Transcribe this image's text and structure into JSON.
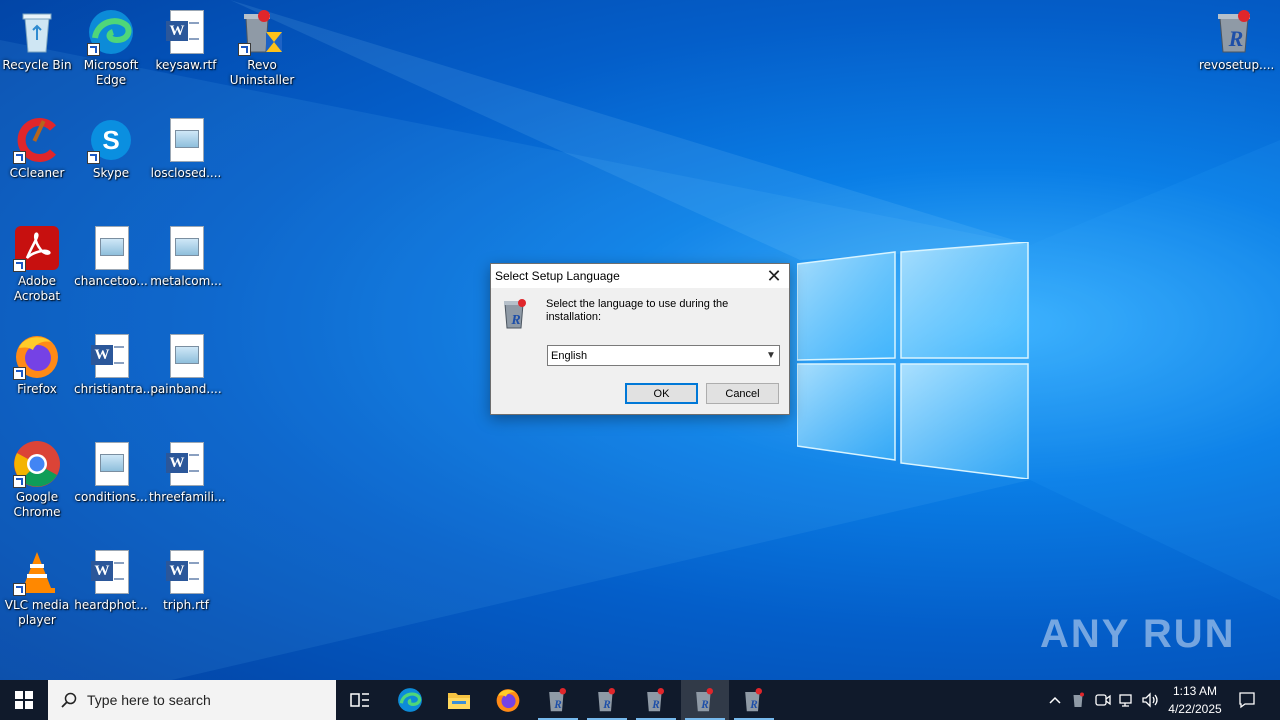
{
  "desktop": {
    "icons": [
      {
        "label": "Recycle Bin"
      },
      {
        "label": "Microsoft Edge"
      },
      {
        "label": "keysaw.rtf"
      },
      {
        "label": "Revo Uninstaller"
      },
      {
        "label": "CCleaner"
      },
      {
        "label": "Skype"
      },
      {
        "label": "losclosed...."
      },
      {
        "label": "Adobe Acrobat"
      },
      {
        "label": "chancetoo..."
      },
      {
        "label": "metalcom..."
      },
      {
        "label": "Firefox"
      },
      {
        "label": "christiantra..."
      },
      {
        "label": "painband...."
      },
      {
        "label": "Google Chrome"
      },
      {
        "label": "conditions..."
      },
      {
        "label": "threefamili..."
      },
      {
        "label": "VLC media player"
      },
      {
        "label": "heardphot..."
      },
      {
        "label": "triph.rtf"
      },
      {
        "label": "revosetup...."
      }
    ]
  },
  "dialog": {
    "title": "Select Setup Language",
    "message": "Select the language to use during the installation:",
    "selected_language": "English",
    "ok_label": "OK",
    "cancel_label": "Cancel"
  },
  "watermark": {
    "text": "ANY RUN"
  },
  "taskbar": {
    "search_placeholder": "Type here to search",
    "clock_time": "1:13 AM",
    "clock_date": "4/22/2025"
  },
  "colors": {
    "taskbar_bg": "#101a2b",
    "accent": "#0078d7",
    "wallpaper_mid": "#0a7ee6"
  }
}
